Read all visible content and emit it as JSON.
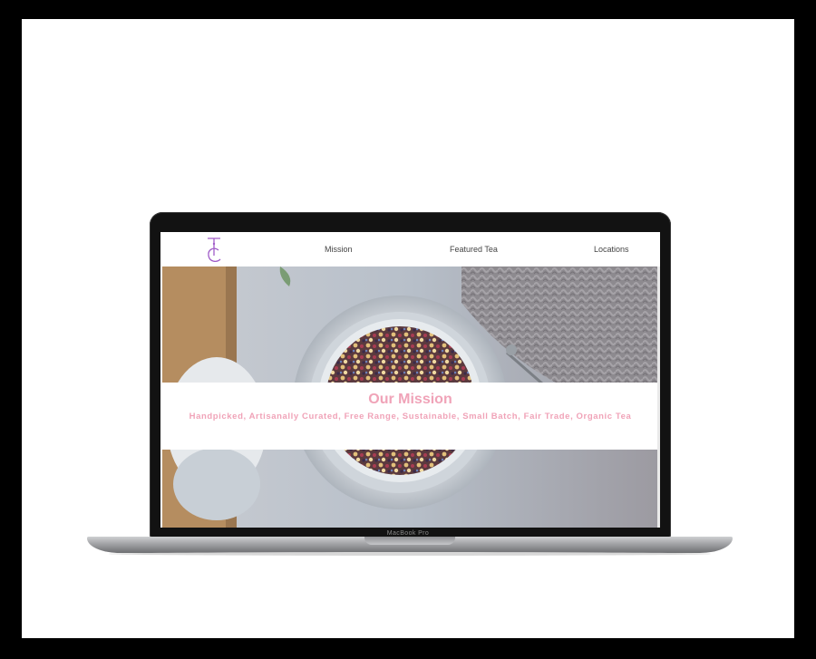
{
  "nav": {
    "logo_alt": "TC",
    "items": [
      {
        "label": "Mission"
      },
      {
        "label": "Featured Tea"
      },
      {
        "label": "Locations"
      }
    ]
  },
  "mission": {
    "title": "Our Mission",
    "subtitle": "Handpicked, Artisanally Curated, Free Range, Sustainable, Small Batch, Fair Trade, Organic Tea"
  },
  "device": {
    "label": "MacBook Pro"
  },
  "colors": {
    "accent_pink": "#f0a3b8",
    "logo_purple": "#a05cc8",
    "frame": "#000000"
  },
  "icons": {
    "logo": "tc-monogram-icon"
  }
}
